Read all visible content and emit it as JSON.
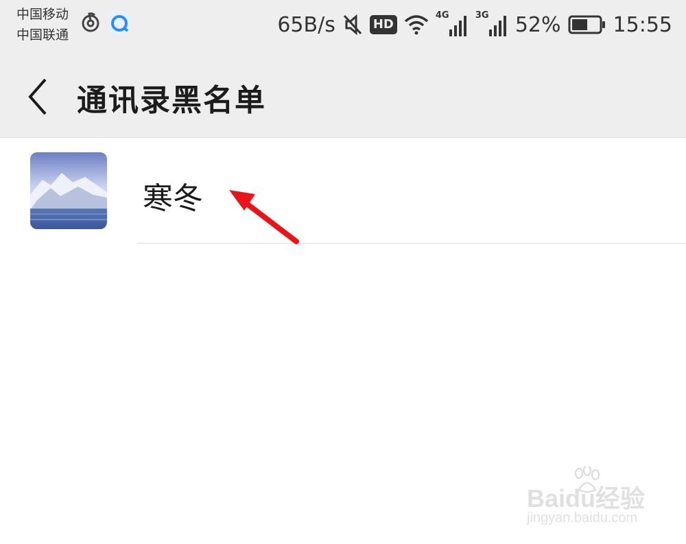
{
  "status_bar": {
    "carriers": [
      "中国移动",
      "中国联通"
    ],
    "net_speed": "65B/s",
    "hd": "HD",
    "signal_1_label": "4G",
    "signal_2_label": "3G",
    "battery": "52%",
    "time": "15:55",
    "icons": [
      "netease-music-icon",
      "browser-icon",
      "mute-icon",
      "wifi-icon",
      "signal-icon",
      "battery-icon"
    ]
  },
  "title_bar": {
    "title": "通讯录黑名单",
    "back_icon": "chevron-left-icon"
  },
  "blacklist": {
    "items": [
      {
        "name": "寒冬",
        "avatar": "snow-mountain-photo"
      }
    ]
  },
  "annotation": {
    "arrow_color": "#e8141a"
  },
  "watermark": {
    "brand": "Baidu经验",
    "url": "jingyan.baidu.com"
  },
  "colors": {
    "bar_bg": "#eeeeee",
    "text": "#1a1a1a",
    "divider": "#dcdcdc"
  }
}
